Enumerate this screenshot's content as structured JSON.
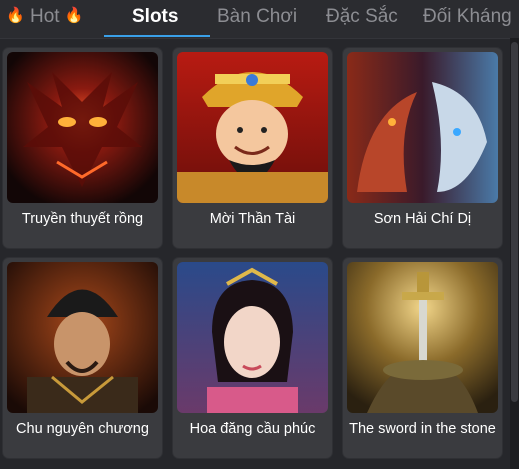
{
  "tabs": [
    {
      "label": "Hot",
      "icon": "fire-icon",
      "active": false
    },
    {
      "label": "Slots",
      "active": true
    },
    {
      "label": "Bàn Chơi",
      "active": false
    },
    {
      "label": "Đặc Sắc",
      "active": false
    },
    {
      "label": "Đối Kháng",
      "active": false
    }
  ],
  "games": [
    {
      "title": "Truyền thuyết rồng",
      "art": "red-dragon-art"
    },
    {
      "title": "Mời Thần Tài",
      "art": "god-of-wealth-art"
    },
    {
      "title": "Sơn Hải Chí Dị",
      "art": "dragon-tiger-art"
    },
    {
      "title": "Chu nguyên chương",
      "art": "emperor-portrait-art"
    },
    {
      "title": "Hoa đăng cầu phúc",
      "art": "lady-portrait-art"
    },
    {
      "title": "The sword in the stone",
      "art": "sword-stone-art"
    }
  ],
  "colors": {
    "background": "#26272b",
    "card": "#3a3b3f",
    "active_tab": "#ffffff",
    "inactive_tab": "#8c8d92",
    "accent_underline": "#3aa0e8"
  }
}
